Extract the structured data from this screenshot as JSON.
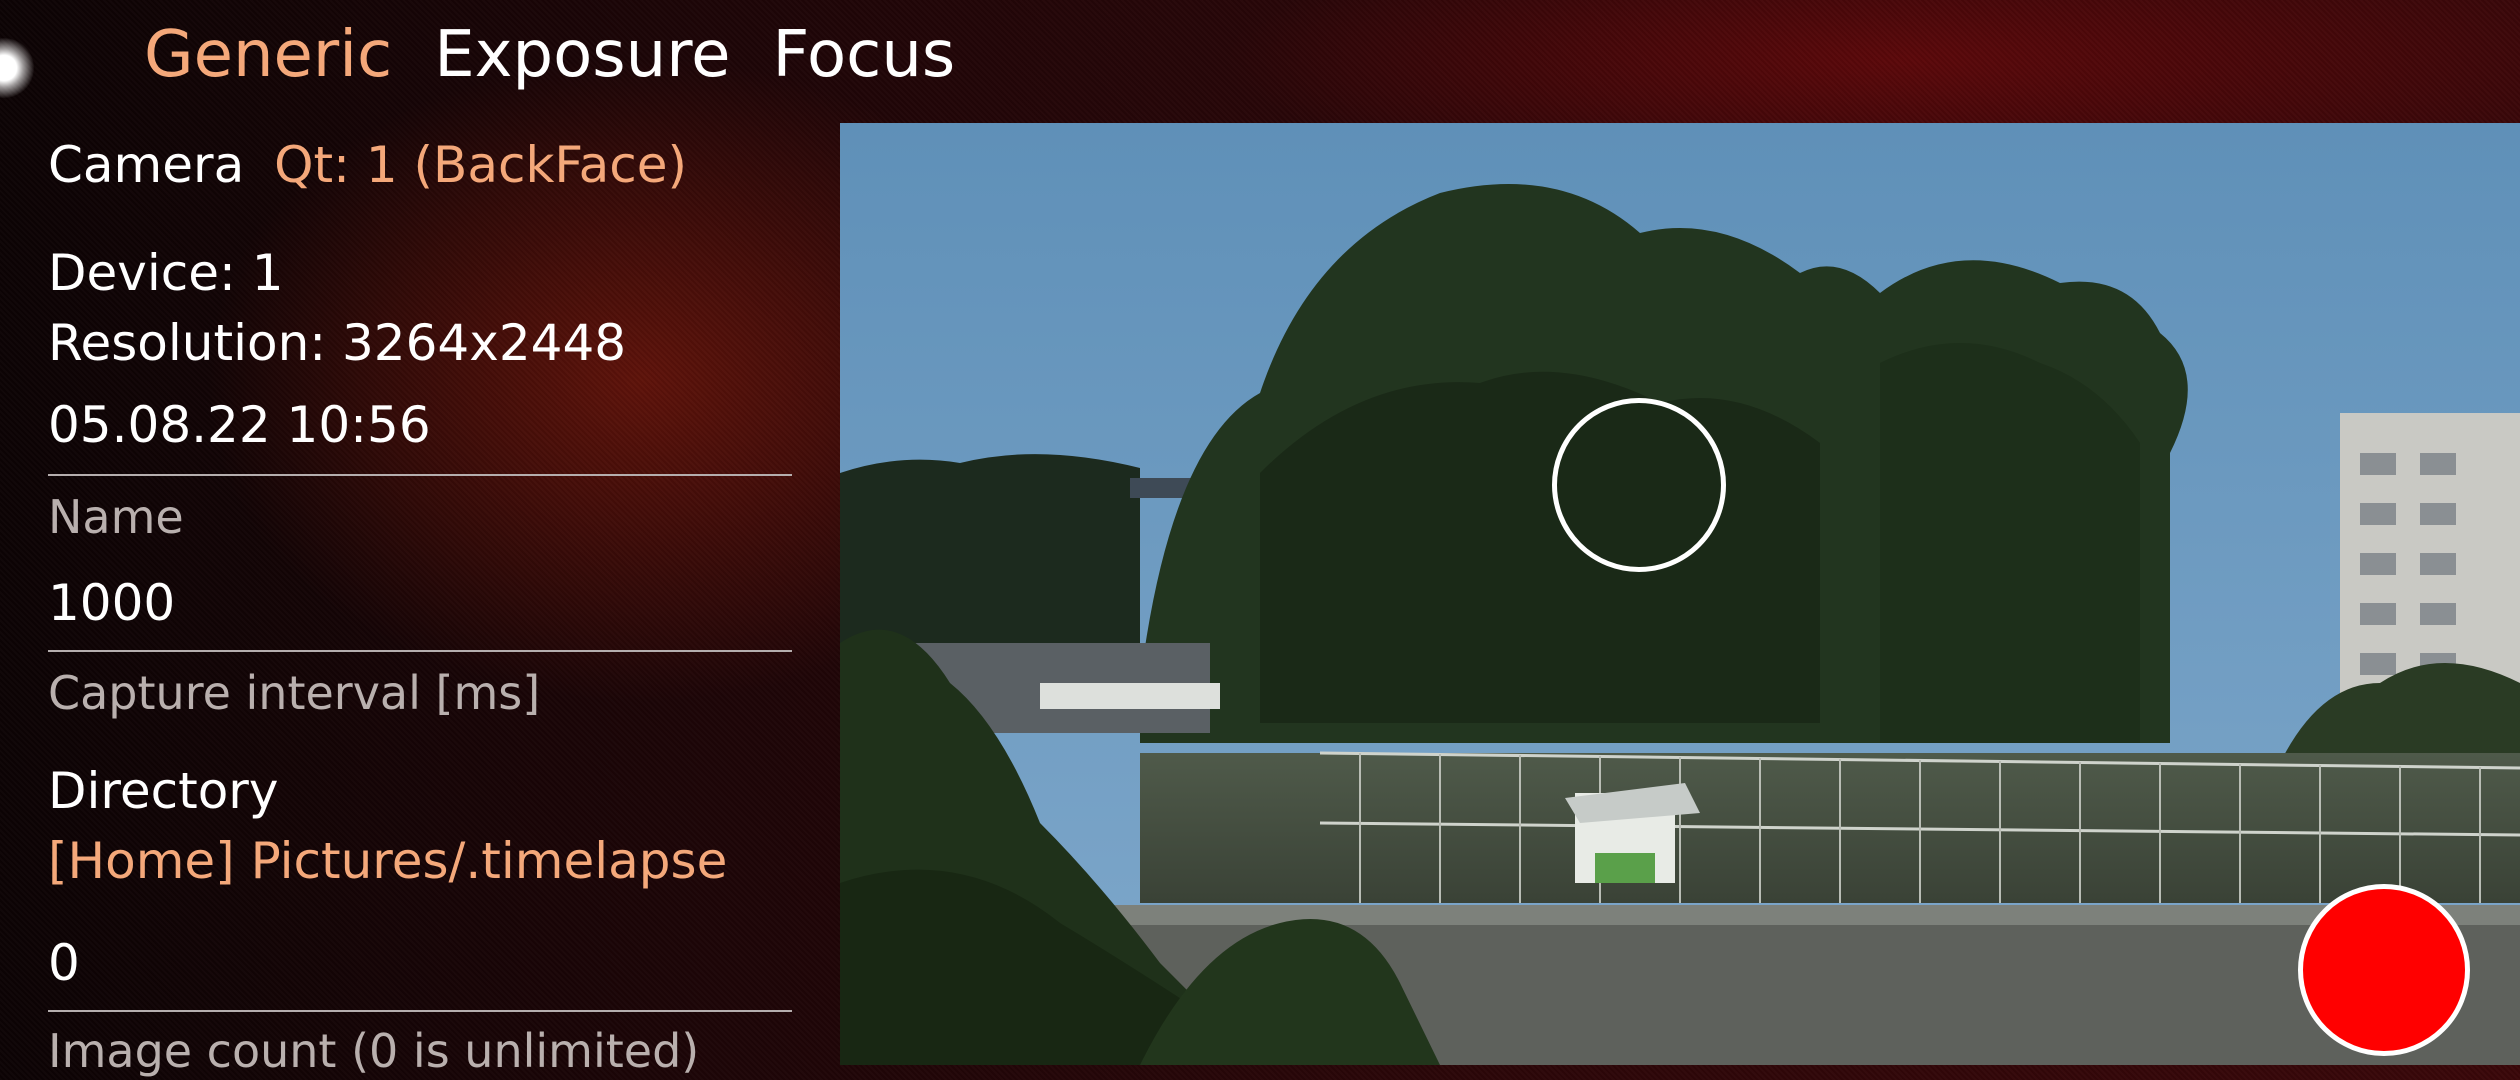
{
  "tabs": [
    {
      "label": "Generic",
      "active": true
    },
    {
      "label": "Exposure",
      "active": false
    },
    {
      "label": "Focus",
      "active": false
    }
  ],
  "camera": {
    "label": "Camera",
    "value": "Qt: 1 (BackFace)"
  },
  "info": {
    "device": "Device: 1",
    "resolution": "Resolution: 3264x2448",
    "datetime": "05.08.22 10:56"
  },
  "name_field": {
    "label": "Name"
  },
  "capture_interval": {
    "value": "1000",
    "label": "Capture interval [ms]"
  },
  "directory": {
    "label": "Directory",
    "value": "[Home] Pictures/.timelapse"
  },
  "image_count": {
    "value": "0",
    "label": "Image count (0 is unlimited)"
  },
  "colors": {
    "accent": "#f4a87a",
    "record": "#ff0000",
    "text": "#ffffff",
    "muted": "#b9b0ae"
  },
  "icons": {
    "focus_indicator": "focus-circle-icon",
    "record": "record-button"
  }
}
